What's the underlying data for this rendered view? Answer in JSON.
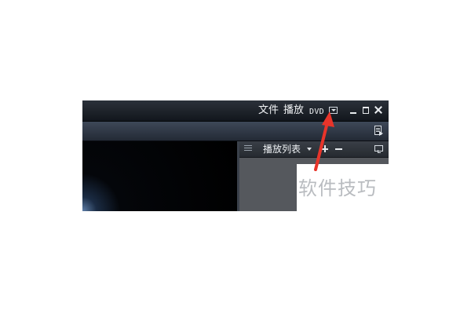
{
  "titlebar": {
    "menu": {
      "file": "文件",
      "play": "播放",
      "dvd": "DVD"
    }
  },
  "playlist": {
    "title": "播放列表"
  },
  "watermark": {
    "text": "软件技巧"
  },
  "annotation": {
    "arrow_color": "#e8342a"
  },
  "colors": {
    "titlebar": "#1c2128",
    "toolbar": "#2f3744",
    "video_bg": "#000000",
    "playlist_bg": "#55585d"
  }
}
